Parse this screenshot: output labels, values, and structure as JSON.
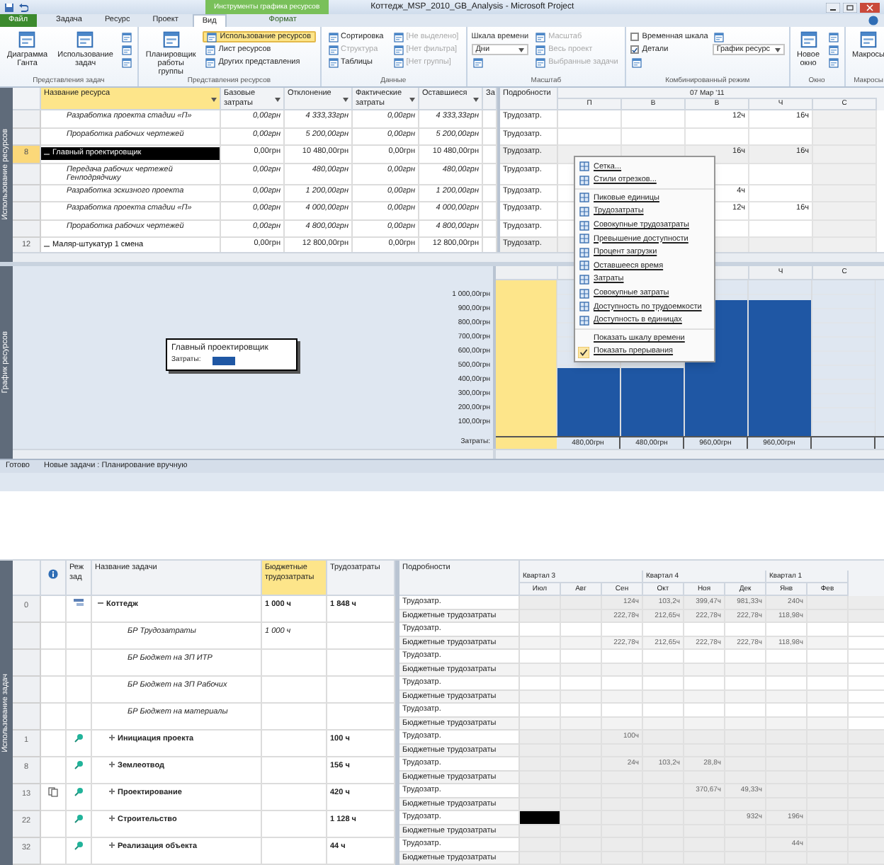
{
  "title_bar": {
    "context_header": "Инструменты графика ресурсов",
    "title": "Коттедж_MSP_2010_GB_Analysis - Microsoft Project"
  },
  "ribbon_tabs": [
    {
      "label": "Файл",
      "kind": "file",
      "selected": false
    },
    {
      "label": "Задача",
      "kind": "tab",
      "selected": false
    },
    {
      "label": "Ресурс",
      "kind": "tab",
      "selected": false
    },
    {
      "label": "Проект",
      "kind": "tab",
      "selected": false
    },
    {
      "label": "Вид",
      "kind": "tab",
      "selected": true
    },
    {
      "label": "Формат",
      "kind": "context",
      "selected": false
    }
  ],
  "ribbon_groups": [
    {
      "label": "Представления задач",
      "controls": [
        {
          "kind": "large",
          "label": "Диаграмма Ганта",
          "selected": false
        },
        {
          "kind": "large",
          "label": "Использование задач",
          "selected": false
        },
        {
          "kind": "icon"
        },
        {
          "kind": "icon"
        },
        {
          "kind": "icon"
        }
      ]
    },
    {
      "label": "Представления ресурсов",
      "controls": [
        {
          "kind": "large",
          "label": "Планировщик работы группы",
          "selected": false
        },
        {
          "kind": "small",
          "label": "Использование ресурсов",
          "selected": true
        },
        {
          "kind": "small",
          "label": "Лист ресурсов",
          "selected": false
        },
        {
          "kind": "small",
          "label": "Других представления",
          "selected": false
        }
      ]
    },
    {
      "label": "Данные",
      "controls": [
        {
          "kind": "small",
          "label": "Сортировка",
          "disabled": false
        },
        {
          "kind": "small",
          "label": "Структура",
          "disabled": true
        },
        {
          "kind": "small",
          "label": "Таблицы",
          "disabled": false
        },
        {
          "kind": "small",
          "label": "[Не выделено]",
          "disabled": true
        },
        {
          "kind": "small",
          "label": "[Нет фильтра]",
          "disabled": true
        },
        {
          "kind": "small",
          "label": "[Нет группы]",
          "disabled": true
        }
      ]
    },
    {
      "label": "Масштаб",
      "controls": [
        {
          "kind": "label",
          "label": "Шкала времени"
        },
        {
          "kind": "select",
          "label": "Дни"
        },
        {
          "kind": "icon"
        },
        {
          "kind": "small",
          "label": "Масштаб",
          "disabled": true
        },
        {
          "kind": "small",
          "label": "Весь проект",
          "disabled": true
        },
        {
          "kind": "small",
          "label": "Выбранные задачи",
          "disabled": true
        }
      ]
    },
    {
      "label": "Комбинированный режим",
      "controls": [
        {
          "kind": "check",
          "label": "Временная шкала",
          "checked": false
        },
        {
          "kind": "check",
          "label": "Детали",
          "checked": true
        },
        {
          "kind": "icon"
        },
        {
          "kind": "icon"
        },
        {
          "kind": "select",
          "label": "График ресурс"
        }
      ]
    },
    {
      "label": "Окно",
      "controls": [
        {
          "kind": "large",
          "label": "Новое окно",
          "selected": false
        },
        {
          "kind": "icon"
        },
        {
          "kind": "icon"
        },
        {
          "kind": "icon"
        }
      ]
    },
    {
      "label": "Макросы",
      "controls": [
        {
          "kind": "large",
          "label": "Макросы",
          "selected": false
        }
      ]
    }
  ],
  "resource_view": {
    "side_label": "Использование ресурсов",
    "columns": [
      {
        "label": "Название ресурса",
        "highlighted": true
      },
      {
        "label": "Базовые затраты",
        "highlighted": false
      },
      {
        "label": "Отклонение",
        "highlighted": false
      },
      {
        "label": "Фактические затраты",
        "highlighted": false
      },
      {
        "label": "Оставшиеся",
        "highlighted": false
      },
      {
        "label": "За",
        "highlighted": false
      }
    ],
    "detail_header": "Подробности",
    "date": "07 Мар '11",
    "days": [
      "П",
      "В",
      "В",
      "Ч",
      "С"
    ],
    "rows": [
      {
        "kind": "assignment",
        "name": "Разработка проекта стадии «П»",
        "values": [
          "0,00грн",
          "4 333,33грн",
          "0,00грн",
          "4 333,33грн"
        ],
        "detail": "Трудозатр.",
        "timeline": {
          "col_3": "12ч",
          "col_4": "16ч"
        }
      },
      {
        "kind": "assignment",
        "name": "Проработка рабочих чертежей",
        "values": [
          "0,00грн",
          "5 200,00грн",
          "0,00грн",
          "5 200,00грн"
        ],
        "detail": "Трудозатр."
      },
      {
        "kind": "resource",
        "id": "8",
        "name": "Главный проектировщик",
        "expanded": true,
        "selected": true,
        "values": [
          "0,00грн",
          "10 480,00грн",
          "0,00грн",
          "10 480,00грн"
        ],
        "detail": "Трудозатр.",
        "timeline": {
          "col_3": "16ч",
          "col_4": "16ч"
        },
        "children": [
          {
            "kind": "assignment",
            "name": "Передача рабочих чертежей Генподрядчику",
            "values": [
              "0,00грн",
              "480,00грн",
              "0,00грн",
              "480,00грн"
            ],
            "detail": "Трудозатр."
          },
          {
            "kind": "assignment",
            "name": "Разработка эскизного проекта",
            "values": [
              "0,00грн",
              "1 200,00грн",
              "0,00грн",
              "1 200,00грн"
            ],
            "detail": "Трудозатр.",
            "timeline": {
              "col_3": "4ч"
            }
          },
          {
            "kind": "assignment",
            "name": "Разработка проекта стадии «П»",
            "values": [
              "0,00грн",
              "4 000,00грн",
              "0,00грн",
              "4 000,00грн"
            ],
            "detail": "Трудозатр.",
            "timeline": {
              "col_3": "12ч",
              "col_4": "16ч"
            }
          },
          {
            "kind": "assignment",
            "name": "Проработка рабочих чертежей",
            "values": [
              "0,00грн",
              "4 800,00грн",
              "0,00грн",
              "4 800,00грн"
            ],
            "detail": "Трудозатр."
          }
        ]
      },
      {
        "kind": "resource",
        "id": "12",
        "name": "Маляр-штукатур 1 смена",
        "expanded": true,
        "selected": false,
        "values": [
          "0,00грн",
          "12 800,00грн",
          "0,00грн",
          "12 800,00грн"
        ],
        "detail": "Трудозатр."
      }
    ]
  },
  "context_menu": {
    "groups": [
      [
        {
          "label": "Сетка..."
        },
        {
          "label": "Стили отрезков..."
        }
      ],
      [
        {
          "label": "Пиковые единицы"
        },
        {
          "label": "Трудозатраты"
        },
        {
          "label": "Совокупные трудозатраты"
        },
        {
          "label": "Превышение доступности"
        },
        {
          "label": "Процент загрузки"
        },
        {
          "label": "Оставшееся время"
        },
        {
          "label": "Затраты"
        },
        {
          "label": "Совокупные затраты"
        },
        {
          "label": "Доступность по трудоемкости"
        },
        {
          "label": "Доступность в единицах"
        }
      ],
      [
        {
          "label": "Показать шкалу времени",
          "checked": false
        },
        {
          "label": "Показать прерывания",
          "checked": true
        }
      ]
    ]
  },
  "resource_graph": {
    "side_label": "График ресурсов",
    "legend_title": "Главный проектировщик",
    "days": [
      "Ч",
      "С"
    ],
    "row_label": "Затраты:",
    "chart_data": {
      "type": "bar",
      "grid": true,
      "ylim": [
        0,
        1100
      ],
      "yticks": [
        {
          "value": 100,
          "label": "100,00грн"
        },
        {
          "value": 200,
          "label": "200,00грн"
        },
        {
          "value": 300,
          "label": "300,00грн"
        },
        {
          "value": 400,
          "label": "400,00грн"
        },
        {
          "value": 500,
          "label": "500,00грн"
        },
        {
          "value": 600,
          "label": "600,00грн"
        },
        {
          "value": 700,
          "label": "700,00грн"
        },
        {
          "value": 800,
          "label": "800,00грн"
        },
        {
          "value": 900,
          "label": "900,00грн"
        },
        {
          "value": 1000,
          "label": "1 000,00грн"
        }
      ],
      "categories": [
        null,
        null,
        null,
        null
      ],
      "series": [
        {
          "name": "Затраты:",
          "color": "#1f57a4",
          "values": [
            480,
            480,
            960,
            960
          ]
        }
      ],
      "value_labels": [
        "480,00грн",
        "480,00грн",
        "960,00грн",
        "960,00грн"
      ]
    }
  },
  "status_bar": {
    "ready": "Готово",
    "mode": "Новые задачи : Планирование вручную"
  },
  "task_usage": {
    "side_label": "Использование задач",
    "columns": [
      {
        "label": "Реж зад",
        "highlighted": false
      },
      {
        "label": "Название задачи",
        "highlighted": false
      },
      {
        "label": "Бюджетные трудозатраты",
        "highlighted": true
      },
      {
        "label": "Трудозатраты",
        "highlighted": false
      }
    ],
    "detail_header": "Подробности",
    "quarters": [
      {
        "label": "Квартал 3",
        "months": [
          "Июл",
          "Авг",
          "Сен"
        ]
      },
      {
        "label": "Квартал 4",
        "months": [
          "Окт",
          "Ноя",
          "Дек"
        ]
      },
      {
        "label": "Квартал 1",
        "months": [
          "Янв",
          "Фев"
        ]
      }
    ],
    "rows": [
      {
        "id": "0",
        "kind": "project",
        "name": "Коттедж",
        "budget": "1 000 ч",
        "work": "1 848 ч",
        "expanded": true,
        "indicator": false,
        "details": [
          {
            "label": "Трудозатр.",
            "values": {
              "col_3": "124ч",
              "col_4": "103,2ч",
              "col_5": "399,47ч",
              "col_6": "981,33ч",
              "col_7": "240ч"
            }
          },
          {
            "label": "Бюджетные трудозатраты",
            "values": {
              "col_3": "222,78ч",
              "col_4": "212,65ч",
              "col_5": "222,78ч",
              "col_6": "222,78ч",
              "col_7": "118,98ч"
            }
          }
        ],
        "children": [
          {
            "kind": "budget_resource",
            "name": "БР Трудозатраты",
            "budget": "1 000 ч",
            "details": [
              {
                "label": "Трудозатр."
              },
              {
                "label": "Бюджетные трудозатраты",
                "values": {
                  "col_3": "222,78ч",
                  "col_4": "212,65ч",
                  "col_5": "222,78ч",
                  "col_6": "222,78ч",
                  "col_7": "118,98ч"
                }
              }
            ]
          },
          {
            "kind": "budget_resource",
            "name": "БР Бюджет на ЗП ИТР",
            "details": [
              {
                "label": "Трудозатр."
              },
              {
                "label": "Бюджетные трудозатраты"
              }
            ]
          },
          {
            "kind": "budget_resource",
            "name": "БР Бюджет на ЗП Рабочих",
            "details": [
              {
                "label": "Трудозатр."
              },
              {
                "label": "Бюджетные трудозатраты"
              }
            ]
          },
          {
            "kind": "budget_resource",
            "name": "БР Бюджет на материалы",
            "details": [
              {
                "label": "Трудозатр."
              },
              {
                "label": "Бюджетные трудозатраты"
              }
            ]
          },
          {
            "id": "1",
            "kind": "summary",
            "name": "Инициация проекта",
            "work": "100 ч",
            "expanded": false,
            "indicator": false,
            "details": [
              {
                "label": "Трудозатр.",
                "values": {
                  "col_3": "100ч"
                }
              },
              {
                "label": "Бюджетные трудозатраты"
              }
            ]
          },
          {
            "id": "8",
            "kind": "summary",
            "name": "Землеотвод",
            "work": "156 ч",
            "expanded": false,
            "indicator": false,
            "details": [
              {
                "label": "Трудозатр.",
                "values": {
                  "col_3": "24ч",
                  "col_4": "103,2ч",
                  "col_5": "28,8ч"
                }
              },
              {
                "label": "Бюджетные трудозатраты"
              }
            ]
          },
          {
            "id": "13",
            "kind": "summary",
            "name": "Проектирование",
            "work": "420 ч",
            "expanded": false,
            "indicator": true,
            "details": [
              {
                "label": "Трудозатр.",
                "values": {
                  "col_5": "370,67ч",
                  "col_6": "49,33ч"
                }
              },
              {
                "label": "Бюджетные трудозатраты"
              }
            ]
          },
          {
            "id": "22",
            "kind": "summary",
            "name": "Строительство",
            "work": "1 128 ч",
            "expanded": false,
            "indicator": false,
            "details": [
              {
                "label": "Трудозатр.",
                "selected": {
                  "col_1": true
                },
                "values": {
                  "col_6": "932ч",
                  "col_7": "196ч"
                }
              },
              {
                "label": "Бюджетные трудозатраты"
              }
            ]
          },
          {
            "id": "32",
            "kind": "summary",
            "name": "Реализация объекта",
            "work": "44 ч",
            "expanded": false,
            "indicator": false,
            "details": [
              {
                "label": "Трудозатр.",
                "values": {
                  "col_7": "44ч"
                }
              },
              {
                "label": "Бюджетные трудозатраты"
              }
            ]
          }
        ]
      }
    ]
  }
}
